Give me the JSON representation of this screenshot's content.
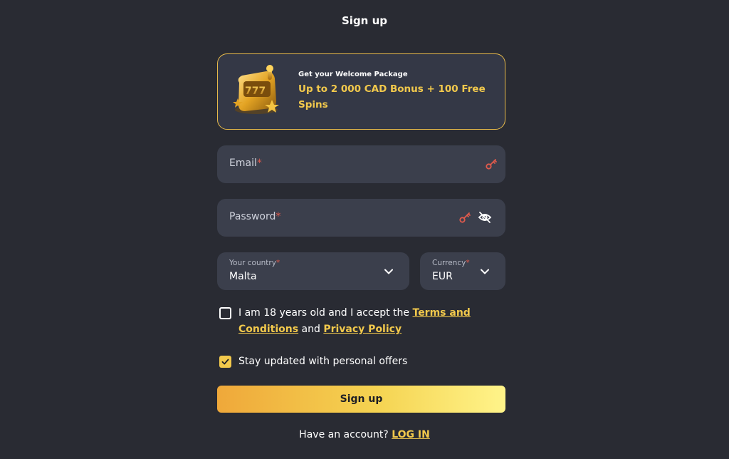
{
  "page": {
    "title": "Sign up"
  },
  "promo": {
    "kicker": "Get your Welcome Package",
    "headline_line1": "Up to 2 000 CAD Bonus + 100 Free",
    "headline_line2": "Spins",
    "image": "slot-machine-777-icon"
  },
  "form": {
    "email": {
      "label": "Email",
      "required_mark": "*",
      "value": "",
      "icon": "key-icon"
    },
    "password": {
      "label": "Password",
      "required_mark": "*",
      "value": "",
      "icons": [
        "key-icon",
        "eye-off-icon"
      ]
    },
    "country": {
      "label": "Your country",
      "required_mark": "*",
      "value": "Malta"
    },
    "currency": {
      "label": "Currency",
      "required_mark": "*",
      "value": "EUR"
    },
    "age_consent": {
      "checked": false,
      "text_before": "I am 18 years old and I accept the",
      "terms_link_line1": "Terms and",
      "terms_link_line2": "Conditions",
      "and_text": "and",
      "privacy_link": "Privacy Policy"
    },
    "offers_consent": {
      "checked": true,
      "text": "Stay updated with personal offers"
    },
    "submit_label": "Sign up"
  },
  "footer": {
    "prompt": "Have an account?",
    "login_link": "LOG IN"
  },
  "colors": {
    "background": "#292b33",
    "field": "#3b3f4c",
    "accent": "#f2c94c",
    "required": "#e05a4c",
    "promo_border": "#e6b94a"
  }
}
